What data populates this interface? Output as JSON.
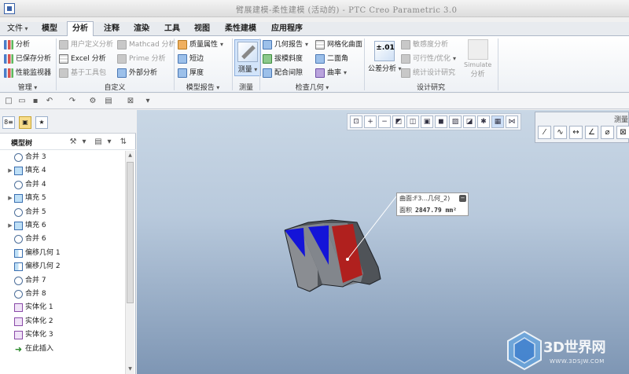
{
  "window": {
    "title": "臂展建模-柔性建模 (活动的) - PTC Creo Parametric 3.0"
  },
  "tabs": [
    {
      "label": "文件",
      "dd": true
    },
    {
      "label": "模型"
    },
    {
      "label": "分析"
    },
    {
      "label": "注释"
    },
    {
      "label": "渲染"
    },
    {
      "label": "工具"
    },
    {
      "label": "视图"
    },
    {
      "label": "柔性建模"
    },
    {
      "label": "应用程序"
    }
  ],
  "ribbon": {
    "manage": {
      "items": [
        "分析",
        "已保存分析",
        "性能监视器"
      ],
      "label": "管理"
    },
    "custom": {
      "items": [
        "用户定义分析",
        "Excel 分析",
        "基于工具包",
        "Mathcad 分析",
        "Prime 分析",
        "外部分析"
      ],
      "label": "自定义"
    },
    "model_report": {
      "items": [
        "质量属性",
        "短边",
        "厚度"
      ],
      "label": "模型报告"
    },
    "measure": {
      "button": "测量",
      "label": "测量"
    },
    "inspect": {
      "items": [
        "几何报告",
        "拔模斜度",
        "配合间隙",
        "网格化曲面",
        "二面角",
        "曲率"
      ],
      "label": "检查几何"
    },
    "design": {
      "tolerance_icon": "±.01",
      "tolerance_button": "公差分析",
      "items": [
        "敏感度分析",
        "可行性/优化",
        "统计设计研究"
      ],
      "simulate_top": "Simulate",
      "simulate_bottom": "分析",
      "label": "设计研究"
    }
  },
  "model_tree": {
    "title": "模型树",
    "items": [
      {
        "label": "合并 3",
        "type": "merge",
        "expand": false
      },
      {
        "label": "填充 4",
        "type": "fill",
        "expand": true
      },
      {
        "label": "合并 4",
        "type": "merge",
        "expand": false
      },
      {
        "label": "填充 5",
        "type": "fill",
        "expand": true
      },
      {
        "label": "合并 5",
        "type": "merge",
        "expand": false
      },
      {
        "label": "填充 6",
        "type": "fill",
        "expand": true
      },
      {
        "label": "合并 6",
        "type": "merge",
        "expand": false
      },
      {
        "label": "偏移几何 1",
        "type": "offset",
        "expand": false
      },
      {
        "label": "偏移几何 2",
        "type": "offset",
        "expand": false
      },
      {
        "label": "合并 7",
        "type": "merge",
        "expand": false
      },
      {
        "label": "合并 8",
        "type": "merge",
        "expand": false
      },
      {
        "label": "实体化 1",
        "type": "solid",
        "expand": false
      },
      {
        "label": "实体化 2",
        "type": "solid",
        "expand": false
      },
      {
        "label": "实体化 3",
        "type": "solid",
        "expand": false
      },
      {
        "label": "在此插入",
        "type": "insert",
        "expand": false
      }
    ]
  },
  "callout": {
    "surface_label": "曲面:F3...几何_2)",
    "area_label": "面积",
    "area_value": "2847.79 mm²"
  },
  "measure_panel": {
    "title": "测量"
  },
  "watermark": {
    "text": "3D世界网",
    "url": "WWW.3DSJW.COM"
  },
  "colors": {
    "blue_face": "#1414d8",
    "red_face": "#b0201e",
    "gray_face": "#8a8d92"
  }
}
